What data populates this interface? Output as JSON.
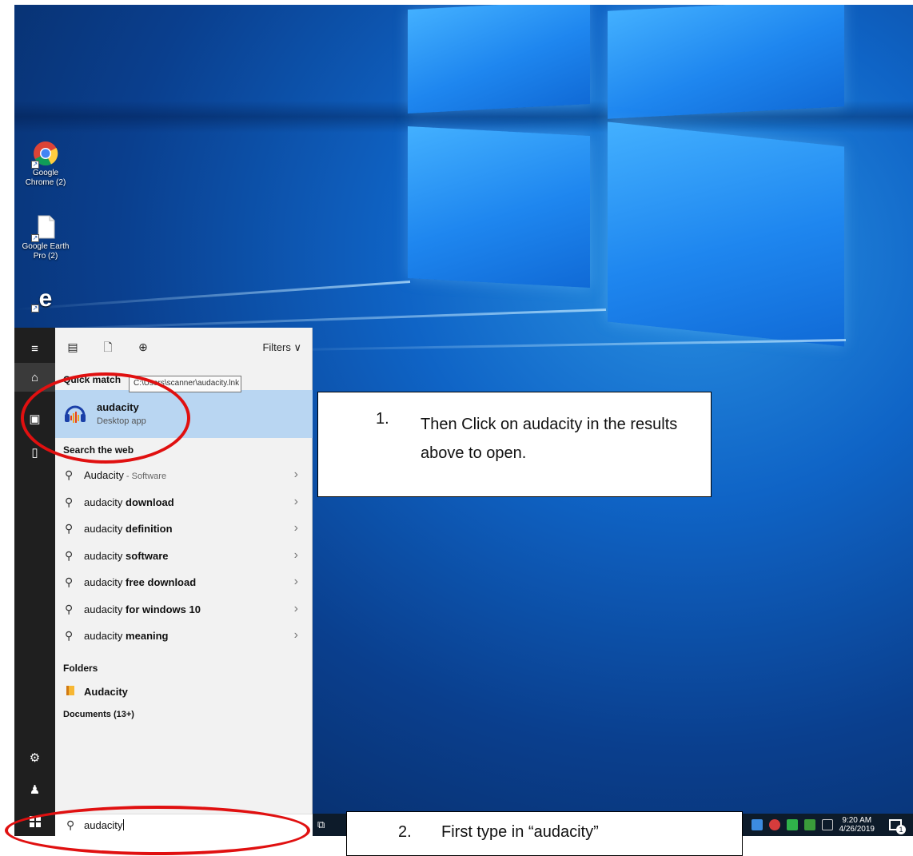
{
  "desktop": {
    "icons": [
      {
        "label": "Google Chrome (2)",
        "icon": "chrome-icon"
      },
      {
        "label": "Google Earth Pro (2)",
        "icon": "file-icon"
      },
      {
        "label": "Microsoft Edge",
        "icon": "edge-icon"
      }
    ]
  },
  "search_panel": {
    "filters_label": "Filters",
    "best_match_header": "Quick match",
    "tooltip": "C:\\Users\\scanner\\audacity.lnk",
    "best_match": {
      "name": "audacity",
      "type": "Desktop app"
    },
    "web_header": "Search the web",
    "web_results": [
      {
        "prefix": "Audacity",
        "bold": "",
        "suffix": " - Software"
      },
      {
        "prefix": "audacity ",
        "bold": "download",
        "suffix": ""
      },
      {
        "prefix": "audacity ",
        "bold": "definition",
        "suffix": ""
      },
      {
        "prefix": "audacity ",
        "bold": "software",
        "suffix": ""
      },
      {
        "prefix": "audacity ",
        "bold": "free download",
        "suffix": ""
      },
      {
        "prefix": "audacity ",
        "bold": "for windows 10",
        "suffix": ""
      },
      {
        "prefix": "audacity ",
        "bold": "meaning",
        "suffix": ""
      }
    ],
    "folders_header": "Folders",
    "folder_name": "Audacity",
    "documents_header": "Documents (13+)",
    "search_value": "audacity"
  },
  "taskbar": {
    "time": "9:20 AM",
    "date": "4/26/2019",
    "notification_count": "1"
  },
  "instructions": {
    "step1_number": "1.",
    "step1_text": "Then Click on audacity in the results above to open.",
    "step2_number": "2.",
    "step2_text": "First type in “audacity”"
  },
  "colors": {
    "highlight_row": "#b9d6f2",
    "annotation_red": "#e01010",
    "rail_bg": "#1f1f1f",
    "taskbar_bg": "#0d1b2a"
  }
}
